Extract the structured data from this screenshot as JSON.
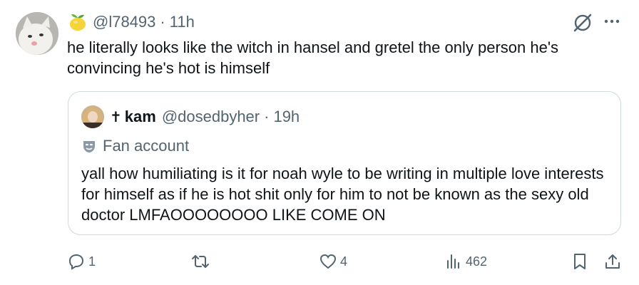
{
  "tweet": {
    "handle": "@l78493",
    "time": "11h",
    "text": "he literally looks like the witch in hansel and gretel the only person he's convincing he's hot is himself",
    "badge_icon": "lemon-icon"
  },
  "quote": {
    "name": "kam",
    "name_prefix": "✝",
    "handle": "@dosedbyher",
    "time": "19h",
    "label": "Fan account",
    "label_icon": "theater-mask-icon",
    "text": "yall how humiliating is it for noah wyle to be writing in multiple love interests for himself as if he is hot shit only for him to not be known as the sexy old doctor LMFAOOOOOOOO LIKE COME ON"
  },
  "actions": {
    "replies": "1",
    "retweets": "",
    "likes": "4",
    "views": "462"
  },
  "separator": "·",
  "colors": {
    "text": "#0f1419",
    "muted": "#536471",
    "border": "#cfd9de"
  }
}
